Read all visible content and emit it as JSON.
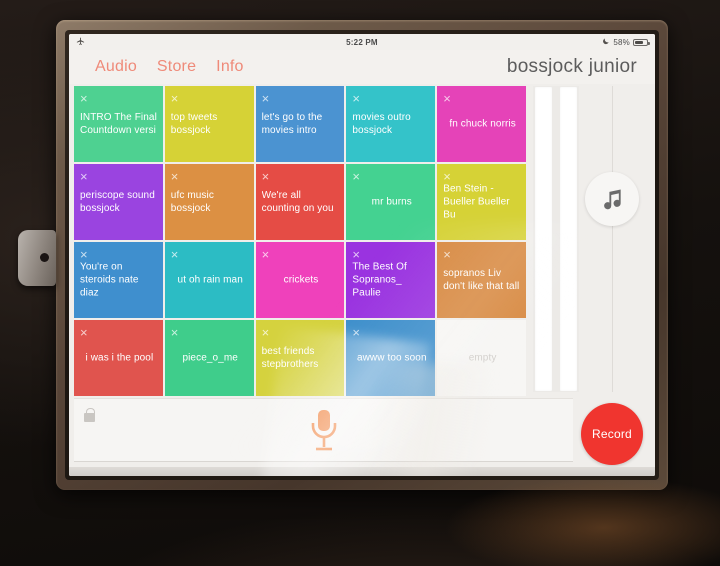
{
  "status_bar": {
    "left_icon": "airplane-icon",
    "time": "5:22 PM",
    "do_not_disturb_icon": "moon-icon",
    "battery_percent": "58%"
  },
  "nav": {
    "links": [
      {
        "label": "Audio",
        "name": "nav-link-audio"
      },
      {
        "label": "Store",
        "name": "nav-link-store"
      },
      {
        "label": "Info",
        "name": "nav-link-info"
      }
    ],
    "app_title": "bossjock junior",
    "accent_color": "#ef8a79"
  },
  "grid": {
    "close_glyph": "×",
    "tiles": [
      {
        "label": "INTRO The Final Countdown versi",
        "color": "#4ed191",
        "align": "left",
        "state": "filled"
      },
      {
        "label": "top tweets bossjock",
        "color": "#d6d236",
        "align": "left",
        "state": "filled"
      },
      {
        "label": "let's go to the movies intro",
        "color": "#4b93d1",
        "align": "left",
        "state": "filled"
      },
      {
        "label": "movies outro bossjock",
        "color": "#34c3c9",
        "align": "left",
        "state": "filled"
      },
      {
        "label": "fn chuck norris",
        "color": "#e543b8",
        "align": "center",
        "state": "filled"
      },
      {
        "label": "periscope sound bossjock",
        "color": "#9a44e0",
        "align": "left",
        "state": "filled"
      },
      {
        "label": "ufc music bossjock",
        "color": "#dc9043",
        "align": "left",
        "state": "filled"
      },
      {
        "label": "We're all counting on you",
        "color": "#e54c45",
        "align": "left",
        "state": "filled"
      },
      {
        "label": "mr burns",
        "color": "#44d291",
        "align": "center",
        "state": "filled"
      },
      {
        "label": "Ben Stein - Bueller Bueller Bu",
        "color": "#d6d236",
        "align": "left",
        "state": "filled"
      },
      {
        "label": "You're on steroids nate diaz",
        "color": "#3f8fce",
        "align": "left",
        "state": "filled"
      },
      {
        "label": "ut oh rain man",
        "color": "#2cbcc4",
        "align": "center",
        "state": "filled"
      },
      {
        "label": "crickets",
        "color": "#ef41bb",
        "align": "center",
        "state": "filled"
      },
      {
        "label": "The Best Of Sopranos_ Paulie",
        "color": "#9a33e0",
        "align": "left",
        "state": "filled"
      },
      {
        "label": "sopranos Liv don't like that tall",
        "color": "#d88a42",
        "align": "left",
        "state": "filled"
      },
      {
        "label": "i was i the pool",
        "color": "#e0544e",
        "align": "center",
        "state": "filled"
      },
      {
        "label": "piece_o_me",
        "color": "#3fcd8b",
        "align": "center",
        "state": "filled"
      },
      {
        "label": "best friends stepbrothers",
        "color": "#d5d23e",
        "align": "left",
        "state": "filled"
      },
      {
        "label": "awww too soon",
        "color": "#3c8ecb",
        "align": "center",
        "state": "filled"
      },
      {
        "label": "empty",
        "color": "#f7f6f4",
        "align": "center",
        "state": "empty"
      }
    ]
  },
  "side_controls": {
    "fader_left_name": "volume-fader-left",
    "fader_right_name": "volume-fader-right",
    "music_button_icon": "music-note-icon"
  },
  "bottom_bar": {
    "lock_icon": "lock-icon",
    "mic_icon": "microphone-icon",
    "mic_color": "#f07d35",
    "record_label": "Record",
    "record_color": "#f0352f"
  }
}
